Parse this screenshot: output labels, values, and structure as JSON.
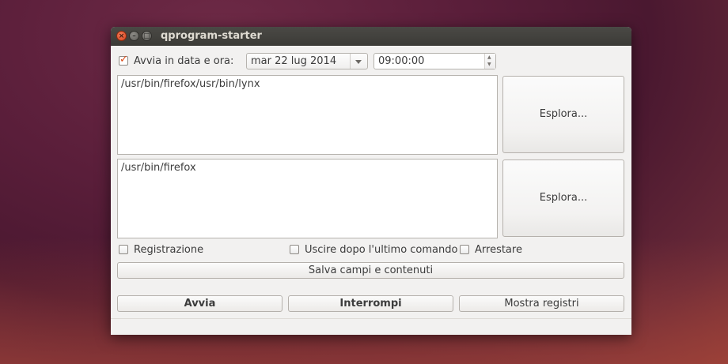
{
  "window": {
    "title": "qprogram-starter"
  },
  "schedule": {
    "checkbox_label": "Avvia in data e ora:",
    "checked": true,
    "date_value": "mar 22 lug 2014",
    "time_value": "09:00:00"
  },
  "commands": [
    {
      "text": "/usr/bin/firefox/usr/bin/lynx",
      "browse_label": "Esplora..."
    },
    {
      "text": "/usr/bin/firefox",
      "browse_label": "Esplora..."
    }
  ],
  "options": {
    "log_label": "Registrazione",
    "exit_after_label": "Uscire dopo l'ultimo comando",
    "shutdown_label": "Arrestare"
  },
  "save_button": "Salva campi e contenuti",
  "actions": {
    "start": "Avvia",
    "stop": "Interrompi",
    "show_logs": "Mostra registri"
  },
  "colors": {
    "accent": "#dd4814",
    "titlebar": "#3c3b37",
    "window_bg": "#f2f1f0"
  }
}
